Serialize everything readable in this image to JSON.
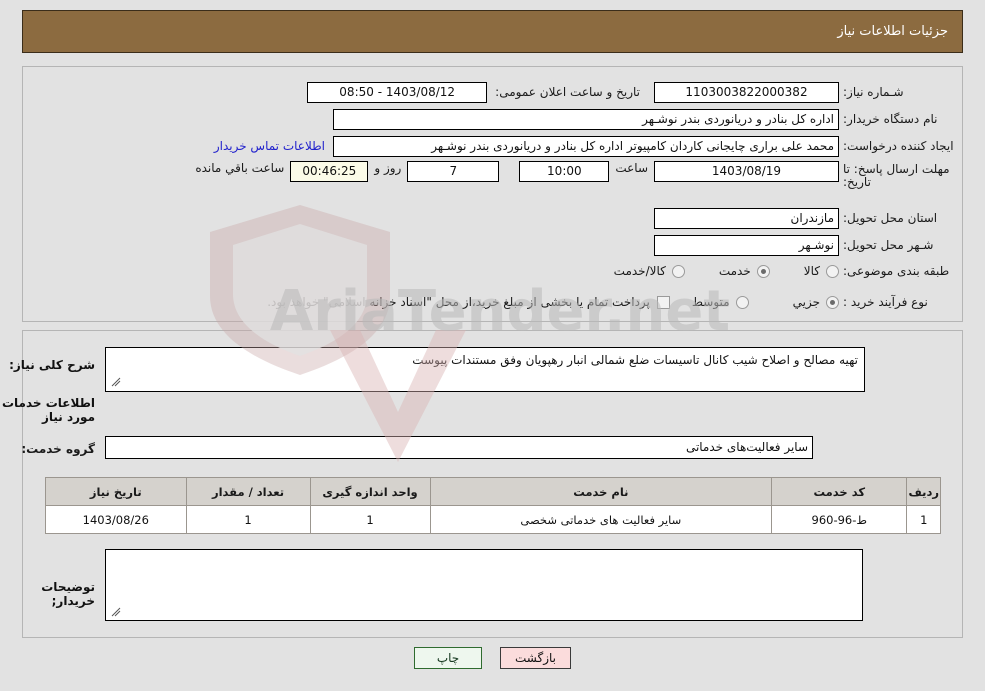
{
  "header": {
    "title": "جزئیات اطلاعات نیاز"
  },
  "top_panel": {
    "need_number_label": "شـماره نیاز:",
    "need_number_value": "1103003822000382",
    "announce_label": "تاریخ و ساعت اعلان عمومی:",
    "announce_value": "1403/08/12 - 08:50",
    "buyer_org_label": "نام دستگاه خریدار:",
    "buyer_org_value": "اداره کل بنادر و دریانوردی بندر نوشـهر",
    "requester_label": "ایجاد کننده درخواست:",
    "requester_value": "محمد علی براری چایجانی کاردان کامپیوتر اداره کل بنادر و دریانوردی بندر نوشـهر",
    "contact_link": "اطلاعات تماس خریدار",
    "deadline_label": "مهلت ارسال پاسخ: تا تاریخ:",
    "deadline_date": "1403/08/19",
    "hour_label": "ساعت",
    "hour_value": "10:00",
    "days_value": "7",
    "days_label": "روز و",
    "timer_value": "00:46:25",
    "remaining_label": "ساعت باقي مانده",
    "province_label": "استان محل تحویل:",
    "province_value": "مازندران",
    "city_label": "شـهر محل تحویل:",
    "city_value": "نوشـهر",
    "category_label": "طبقه بندی موضوعی:",
    "category_options": [
      {
        "label": "کالا",
        "checked": false
      },
      {
        "label": "خدمت",
        "checked": true
      },
      {
        "label": "کالا/خدمت",
        "checked": false
      }
    ],
    "process_label": "نوع فرآیند خرید :",
    "process_options": [
      {
        "label": "جزیي",
        "checked": true
      },
      {
        "label": "متوسط",
        "checked": false
      }
    ],
    "treasury_checkbox_checked": false,
    "treasury_text": "پرداخت تمام یا بخشی از مبلغ خرید،از محل \"اسناد خزانه اسلامی\" خواهد بود."
  },
  "mid_panel": {
    "summary_label": "شرح کلی نیاز:",
    "summary_value": "تهیه مصالح و اصلاح شیب کانال تاسیسات ضلع شمالی انبار رهپویان وفق مستندات پیوست",
    "services_heading": "اطلاعات خدمات مورد نیاز",
    "service_group_label": "گروه خدمت:",
    "service_group_value": "سایر فعالیت‌های خدماتی",
    "table": {
      "columns": [
        "ردیف",
        "کد خدمت",
        "نام خدمت",
        "واحد اندازه گیری",
        "تعداد / مقدار",
        "تاریخ نیاز"
      ],
      "rows": [
        {
          "radif": "1",
          "code": "ط-96-960",
          "name": "سایر فعالیت های خدماتی شخصی",
          "unit": "1",
          "qty": "1",
          "date": "1403/08/26"
        }
      ]
    },
    "buyer_notes_label": "توضیحات خریدار;",
    "buyer_notes_value": ""
  },
  "footer": {
    "print_label": "چاپ",
    "back_label": "بازگشت"
  },
  "watermark": {
    "text": "AriaTender.net"
  }
}
